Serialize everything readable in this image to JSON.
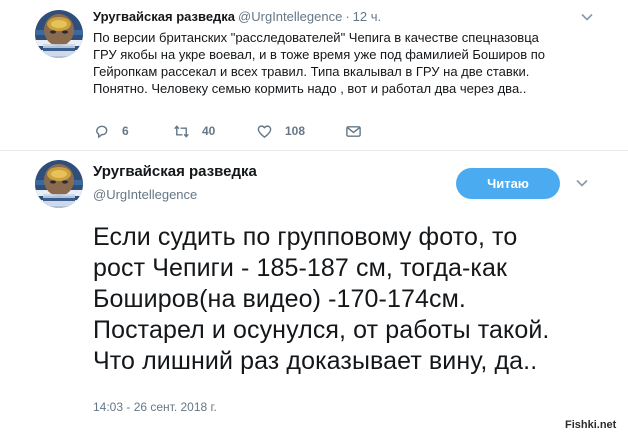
{
  "reply_tweet": {
    "author_name": "Уругвайская разведка",
    "author_handle": "@UrgIntellegence",
    "separator": "·",
    "age": "12 ч.",
    "lines": [
      "По версии британских \"расследователей\" Чепига в качестве спецназовца",
      "ГРУ якобы на укре воевал, и в тоже время уже под фамилией Боширов по",
      "Гейропкам рассекал и всех травил. Типа вкалывал в ГРУ на две ставки.",
      "Понятно. Человеку семью кормить надо , вот и работал два через два.."
    ],
    "actions": {
      "replies": "6",
      "retweets": "40",
      "likes": "108"
    }
  },
  "main_tweet": {
    "author_name": "Уругвайская разведка",
    "author_handle": "@UrgIntellegence",
    "follow_label": "Читаю",
    "lines": [
      "Если судить по групповому фото, то",
      "рост Чепиги - 185-187 см, тогда-как",
      "Боширов(на видео) -170-174см.",
      "Постарел и осунулся, от работы такой.",
      "Что лишний раз доказывает вину, да.."
    ],
    "timestamp": "14:03 - 26 сент. 2018 г."
  },
  "watermark": "Fishki.net",
  "colors": {
    "text": "#14171a",
    "muted": "#657786",
    "accent": "#4aabf0",
    "divider": "#e6ecf0"
  },
  "icons": [
    "reply-icon",
    "retweet-icon",
    "like-icon",
    "message-icon",
    "chevron-down-icon"
  ]
}
